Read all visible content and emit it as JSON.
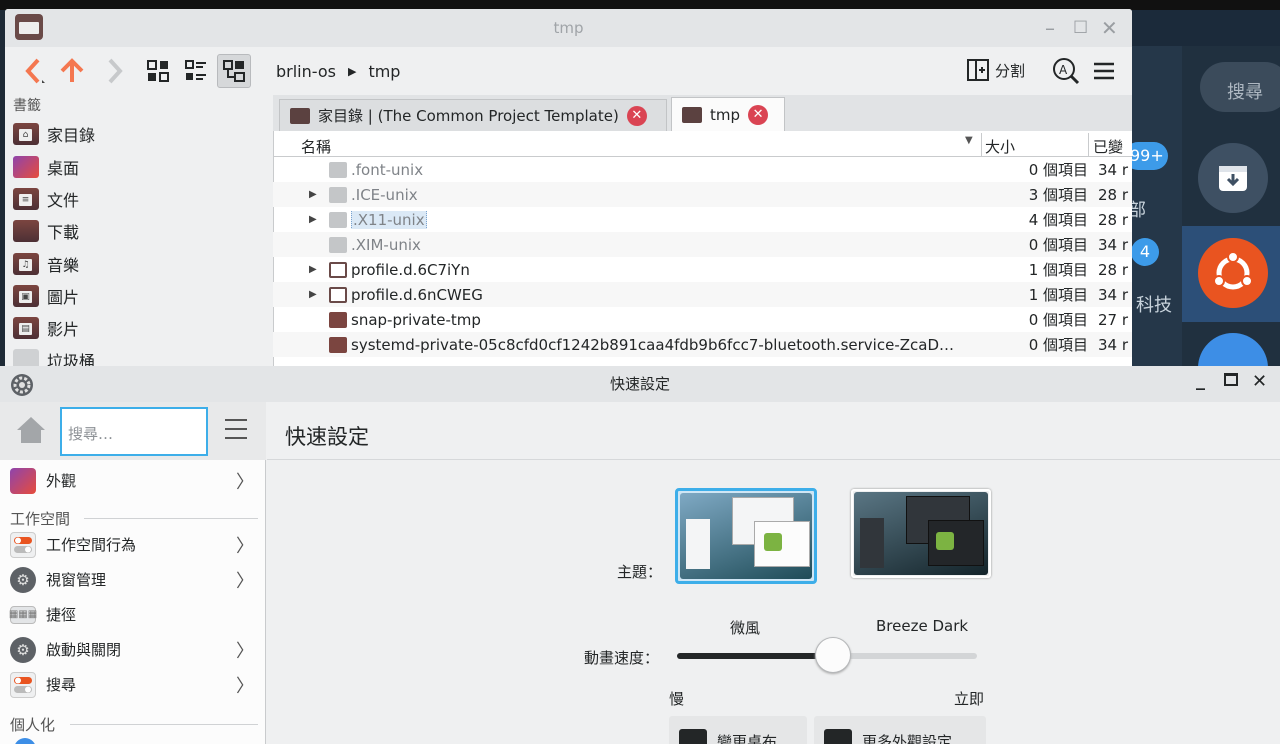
{
  "desktop": {
    "search_label": "搜尋",
    "badge_count": "99+",
    "badge_count2": "4",
    "side_text1": "部",
    "side_text2": "科技"
  },
  "dolphin": {
    "title": "tmp",
    "toolbar": {
      "back_icon": "chevron-left-icon",
      "up_icon": "arrow-up-icon",
      "forward_icon": "chevron-right-icon",
      "split_label": "分割"
    },
    "breadcrumb": [
      "brlin-os",
      "tmp"
    ],
    "sidebar": {
      "heading": "書籤",
      "items": [
        {
          "label": "家目錄",
          "icon": "home-folder-icon"
        },
        {
          "label": "桌面",
          "icon": "desktop-folder-icon"
        },
        {
          "label": "文件",
          "icon": "documents-folder-icon"
        },
        {
          "label": "下載",
          "icon": "downloads-folder-icon"
        },
        {
          "label": "音樂",
          "icon": "music-folder-icon"
        },
        {
          "label": "圖片",
          "icon": "pictures-folder-icon"
        },
        {
          "label": "影片",
          "icon": "videos-folder-icon"
        },
        {
          "label": "垃圾桶",
          "icon": "trash-icon"
        }
      ]
    },
    "tabs": [
      {
        "label": "家目錄 | (The Common Project Template)"
      },
      {
        "label": "tmp"
      }
    ],
    "columns": {
      "name": "名稱",
      "size": "大小",
      "modified": "已變"
    },
    "rows": [
      {
        "name": ".font-unix",
        "size": "0 個項目",
        "date": "34 r",
        "expand": false,
        "icon": "folder-hidden-icon"
      },
      {
        "name": ".ICE-unix",
        "size": "3 個項目",
        "date": "28 r",
        "expand": true,
        "icon": "folder-hidden-icon"
      },
      {
        "name": ".X11-unix",
        "size": "4 個項目",
        "date": "28 r",
        "expand": true,
        "icon": "folder-hidden-icon"
      },
      {
        "name": ".XIM-unix",
        "size": "0 個項目",
        "date": "34 r",
        "expand": false,
        "icon": "folder-hidden-icon"
      },
      {
        "name": "profile.d.6C7iYn",
        "size": "1 個項目",
        "date": "28 r",
        "expand": true,
        "icon": "folder-doc-icon"
      },
      {
        "name": "profile.d.6nCWEG",
        "size": "1 個項目",
        "date": "34 r",
        "expand": true,
        "icon": "folder-doc-icon"
      },
      {
        "name": "snap-private-tmp",
        "size": "0 個項目",
        "date": "27 r",
        "expand": false,
        "icon": "folder-locked-icon"
      },
      {
        "name": "systemd-private-05c8cfd0cf1242b891caa4fdb9b6fcc7-bluetooth.service-ZcaD…",
        "size": "0 個項目",
        "date": "34 r",
        "expand": false,
        "icon": "folder-locked-icon"
      }
    ]
  },
  "settings": {
    "title": "快速設定",
    "search_placeholder": "搜尋…",
    "nav": {
      "appearance": "外觀",
      "section_workspace": "工作空間",
      "workspace_behavior": "工作空間行為",
      "window_management": "視窗管理",
      "shortcuts": "捷徑",
      "startup_shutdown": "啟動與關閉",
      "search": "搜尋",
      "section_personal": "個人化"
    },
    "page_title": "快速設定",
    "theme_label": "主題：",
    "themes": [
      {
        "name": "微風",
        "selected": true
      },
      {
        "name": "Breeze Dark",
        "selected": false
      }
    ],
    "anim_label": "動畫速度：",
    "anim_value": 0.52,
    "anim_min_label": "慢",
    "anim_max_label": "立即",
    "btn_wallpaper": "變更桌布…",
    "btn_more": "更多外觀設定…",
    "accent": "#3daee9"
  }
}
